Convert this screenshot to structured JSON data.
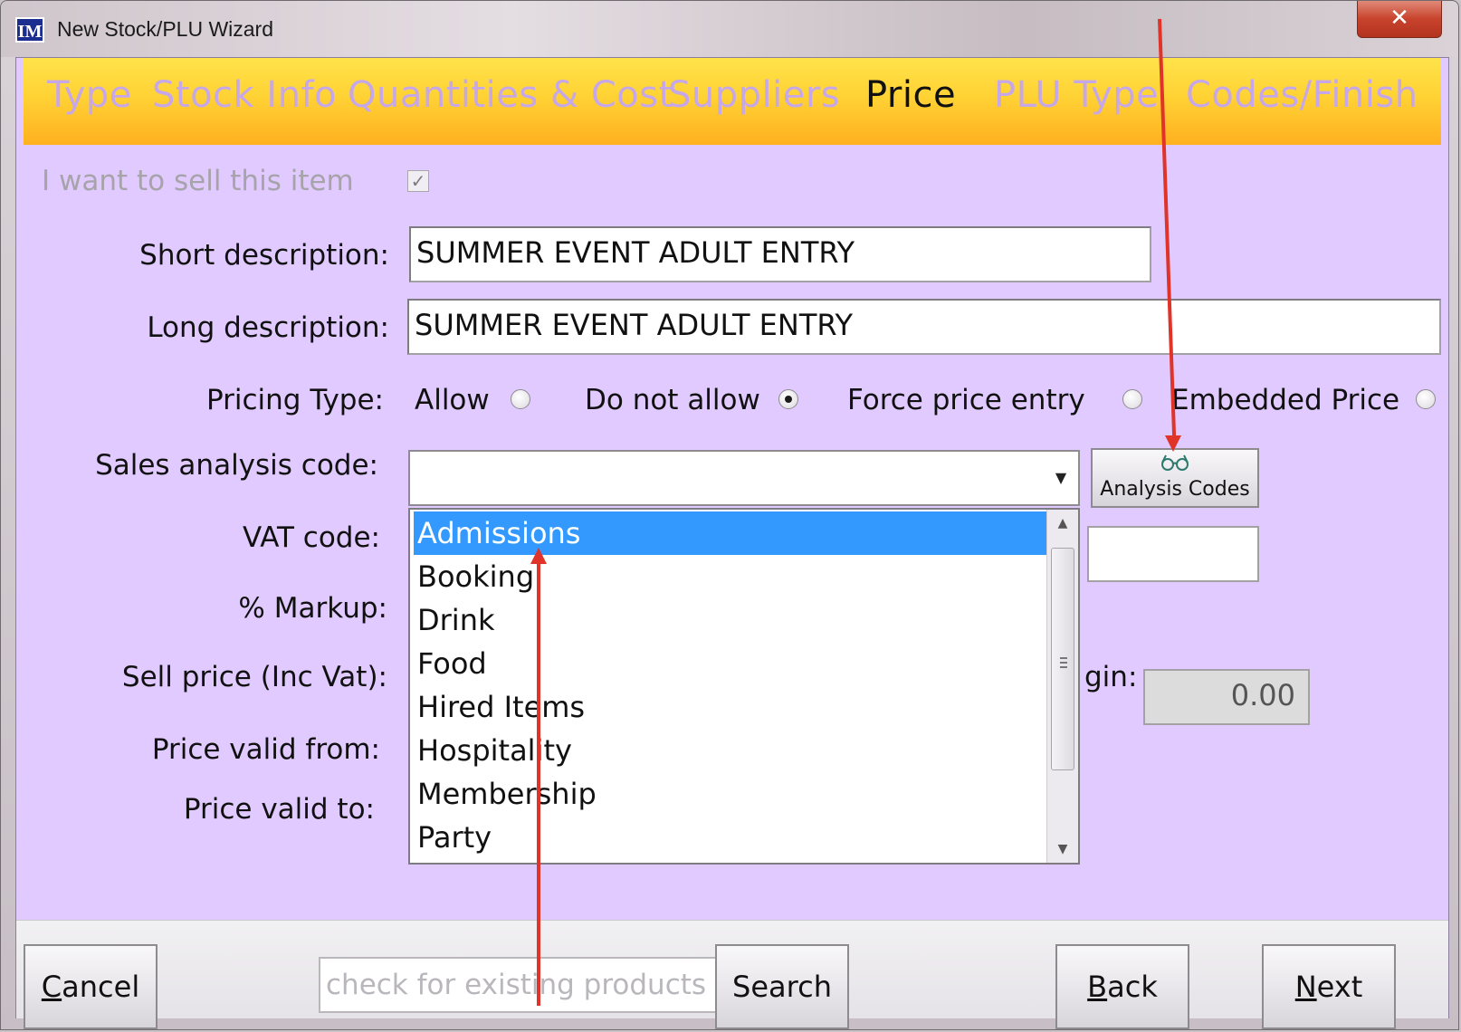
{
  "window": {
    "title": "New Stock/PLU Wizard",
    "icon_text": "IM",
    "close_symbol": "✕"
  },
  "steps": [
    {
      "label": "Type",
      "active": false
    },
    {
      "label": "Stock Info",
      "active": false
    },
    {
      "label": "Quantities & Cost",
      "active": false
    },
    {
      "label": "Suppliers",
      "active": false
    },
    {
      "label": "Price",
      "active": true
    },
    {
      "label": "PLU Type",
      "active": false
    },
    {
      "label": "Codes/Finish",
      "active": false
    }
  ],
  "form": {
    "sell_item_label": "I want to sell this item",
    "sell_item_checked": true,
    "short_description_label": "Short description:",
    "short_description_value": "SUMMER EVENT ADULT ENTRY",
    "long_description_label": "Long description:",
    "long_description_value": "SUMMER EVENT ADULT ENTRY",
    "pricing_type_label": "Pricing Type:",
    "pricing_options": [
      {
        "label": "Allow",
        "checked": false
      },
      {
        "label": "Do not allow",
        "checked": true
      },
      {
        "label": "Force price entry",
        "checked": false
      },
      {
        "label": "Embedded Price",
        "checked": false
      }
    ],
    "sales_analysis_label": "Sales analysis code:",
    "sales_analysis_value": "",
    "analysis_codes_button": "Analysis Codes",
    "vat_code_label": "VAT code:",
    "markup_label": "% Markup:",
    "sell_price_label": "Sell price (Inc Vat):",
    "price_valid_from_label": "Price valid from:",
    "price_valid_to_label": "Price valid to:",
    "margin_label_partial": "gin:",
    "margin_value": "0.00"
  },
  "dropdown": {
    "items": [
      "Admissions",
      "Booking",
      "Drink",
      "Food",
      "Hired Items",
      "Hospitality",
      "Membership",
      "Party"
    ],
    "selected_index": 0
  },
  "footer": {
    "cancel_label": "Cancel",
    "cancel_mnemonic": "C",
    "cancel_rest": "ancel",
    "search_placeholder": "check for existing products",
    "search_label": "Search",
    "back_mnemonic": "B",
    "back_rest": "ack",
    "next_mnemonic": "N",
    "next_rest": "ext"
  },
  "colors": {
    "client_bg": "#e1caff",
    "steps_gradient_top": "#ffe34a",
    "steps_gradient_bottom": "#ffb020",
    "selection": "#3399ff",
    "annotation_arrow": "#e0332a"
  }
}
